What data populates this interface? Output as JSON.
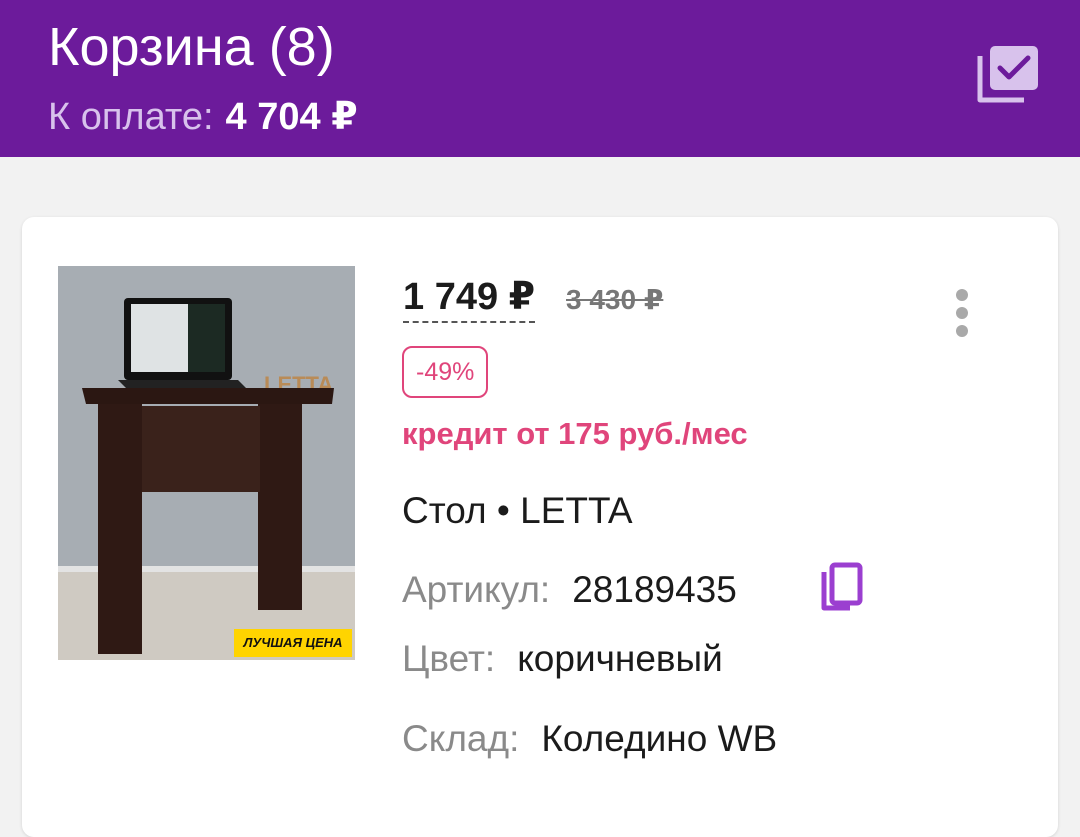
{
  "header": {
    "title": "Корзина (8)",
    "pay_label": "К оплате:",
    "pay_amount": "4 704 ₽",
    "select_icon": "select-all-checkbox-icon"
  },
  "item": {
    "price": "1 749 ₽",
    "old_price": "3 430 ₽",
    "discount": "-49%",
    "credit": "кредит от 175 руб./мес",
    "name": "Стол • LETTA",
    "article_label": "Артикул:",
    "article_value": "28189435",
    "color_label": "Цвет:",
    "color_value": "коричневый",
    "warehouse_label": "Склад:",
    "warehouse_value": "Коледино WB",
    "photo_badge": "ЛУЧШАЯ ЦЕНА",
    "photo_brand": "LETTA"
  },
  "colors": {
    "header_bg": "#6c1b9b",
    "accent_pink": "#e0457b",
    "copy_icon": "#9b3fd0"
  }
}
